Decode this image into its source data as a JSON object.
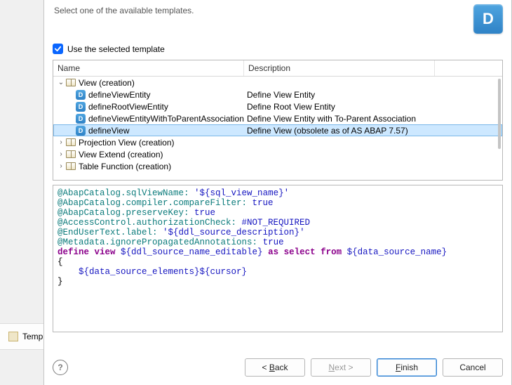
{
  "header": {
    "subtitle": "Select one of the available templates.",
    "logo_letter": "D"
  },
  "checkbox": {
    "label": "Use the selected template",
    "checked": true
  },
  "table": {
    "headers": {
      "name": "Name",
      "description": "Description"
    },
    "groups": [
      {
        "expanded": true,
        "label": "View (creation)",
        "items": [
          {
            "label": "defineViewEntity",
            "desc": "Define View Entity"
          },
          {
            "label": "defineRootViewEntity",
            "desc": "Define Root View Entity"
          },
          {
            "label": "defineViewEntityWithToParentAssociation",
            "desc": "Define View Entity with To-Parent Association"
          },
          {
            "label": "defineView",
            "desc": "Define View (obsolete as of AS ABAP 7.57)",
            "selected": true
          }
        ]
      },
      {
        "expanded": false,
        "label": "Projection View (creation)"
      },
      {
        "expanded": false,
        "label": "View Extend (creation)"
      },
      {
        "expanded": false,
        "label": "Table Function (creation)"
      }
    ]
  },
  "code": {
    "lines": [
      [
        {
          "c": "c-teal",
          "t": "@AbapCatalog.sqlViewName: "
        },
        {
          "c": "c-blue",
          "t": "'${sql_view_name}'"
        }
      ],
      [
        {
          "c": "c-teal",
          "t": "@AbapCatalog.compiler.compareFilter: "
        },
        {
          "c": "c-blue",
          "t": "true"
        }
      ],
      [
        {
          "c": "c-teal",
          "t": "@AbapCatalog.preserveKey: "
        },
        {
          "c": "c-blue",
          "t": "true"
        }
      ],
      [
        {
          "c": "c-teal",
          "t": "@AccessControl.authorizationCheck: "
        },
        {
          "c": "c-blue",
          "t": "#NOT_REQUIRED"
        }
      ],
      [
        {
          "c": "c-teal",
          "t": "@EndUserText.label: "
        },
        {
          "c": "c-blue",
          "t": "'${ddl_source_description}'"
        }
      ],
      [
        {
          "c": "c-teal",
          "t": "@Metadata.ignorePropagatedAnnotations: "
        },
        {
          "c": "c-blue",
          "t": "true"
        }
      ],
      [
        {
          "c": "c-purple",
          "t": "define view "
        },
        {
          "c": "c-blue",
          "t": "${ddl_source_name_editable}"
        },
        {
          "c": "c-purple",
          "t": " as select from "
        },
        {
          "c": "c-blue",
          "t": "${data_source_name}"
        }
      ],
      [
        {
          "c": "c-black",
          "t": "{"
        }
      ],
      [
        {
          "c": "c-black",
          "t": "    "
        },
        {
          "c": "c-blue",
          "t": "${data_source_elements}${cursor}"
        }
      ],
      [
        {
          "c": "c-black",
          "t": "}"
        }
      ]
    ]
  },
  "buttons": {
    "back": "< Back",
    "next": "Next >",
    "finish": "Finish",
    "cancel": "Cancel"
  },
  "bg": {
    "label": "Templa"
  },
  "help_glyph": "?"
}
